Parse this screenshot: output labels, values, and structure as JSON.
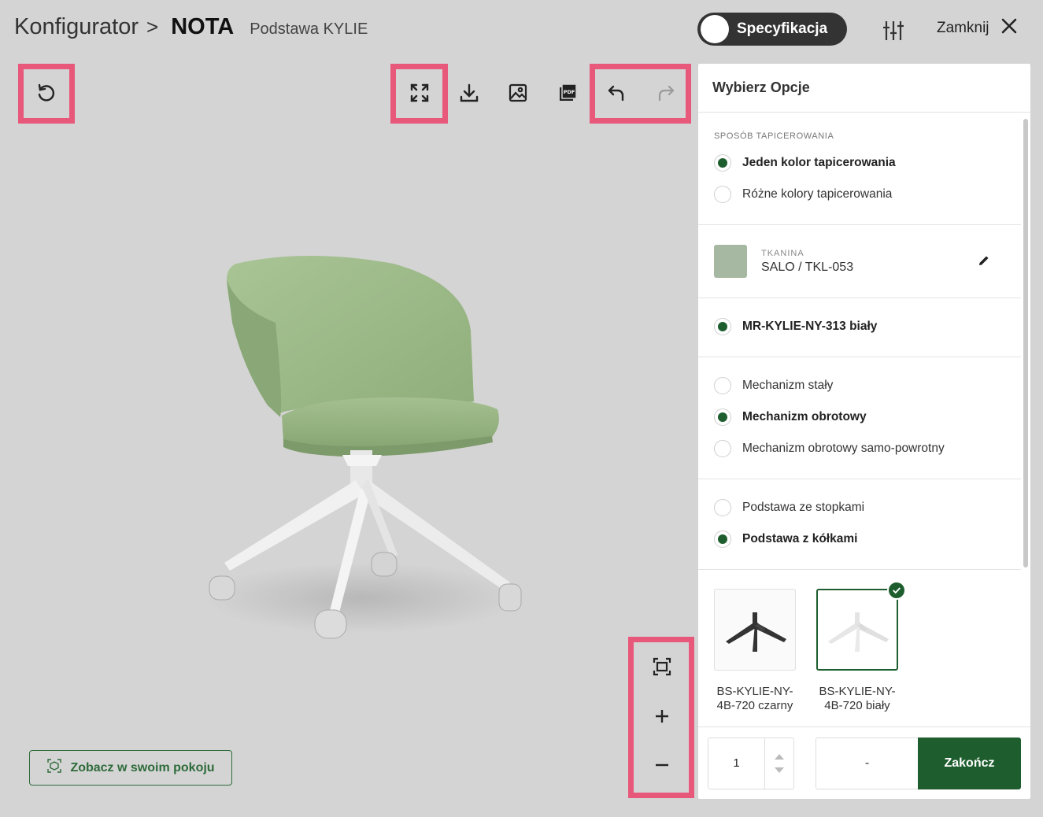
{
  "header": {
    "root": "Konfigurator",
    "separator": ">",
    "product": "NOTA",
    "variant": "Podstawa KYLIE",
    "spec_toggle": "Specyfikacja",
    "close_label": "Zamknij"
  },
  "viewer": {
    "ar_button": "Zobacz w swoim pokoju"
  },
  "panel": {
    "title": "Wybierz Opcje",
    "upholstery": {
      "label": "SPOSÓB TAPICEROWANIA",
      "options": [
        "Jeden kolor tapicerowania",
        "Różne kolory tapicerowania"
      ],
      "selected": 0
    },
    "fabric": {
      "label": "TKANINA",
      "value": "SALO / TKL-053",
      "swatch_color": "#a6b8a2"
    },
    "shell": {
      "options": [
        "MR-KYLIE-NY-313 biały"
      ],
      "selected": 0
    },
    "mechanism": {
      "options": [
        "Mechanizm stały",
        "Mechanizm obrotowy",
        "Mechanizm obrotowy samo-powrotny"
      ],
      "selected": 1
    },
    "base_type": {
      "options": [
        "Podstawa ze stopkami",
        "Podstawa z kółkami"
      ],
      "selected": 1
    },
    "bases": [
      {
        "name": "BS-KYLIE-NY-4B-720 czarny",
        "color": "#333333",
        "selected": false
      },
      {
        "name": "BS-KYLIE-NY-4B-720 biały",
        "color": "#f2f2f2",
        "selected": true
      }
    ],
    "footer": {
      "quantity": "1",
      "price": "-",
      "finish": "Zakończ"
    }
  },
  "colors": {
    "accent": "#1e5e2e",
    "highlight": "#e8587a",
    "background": "#d4d4d4",
    "chair_fabric": "#9cb68a"
  }
}
